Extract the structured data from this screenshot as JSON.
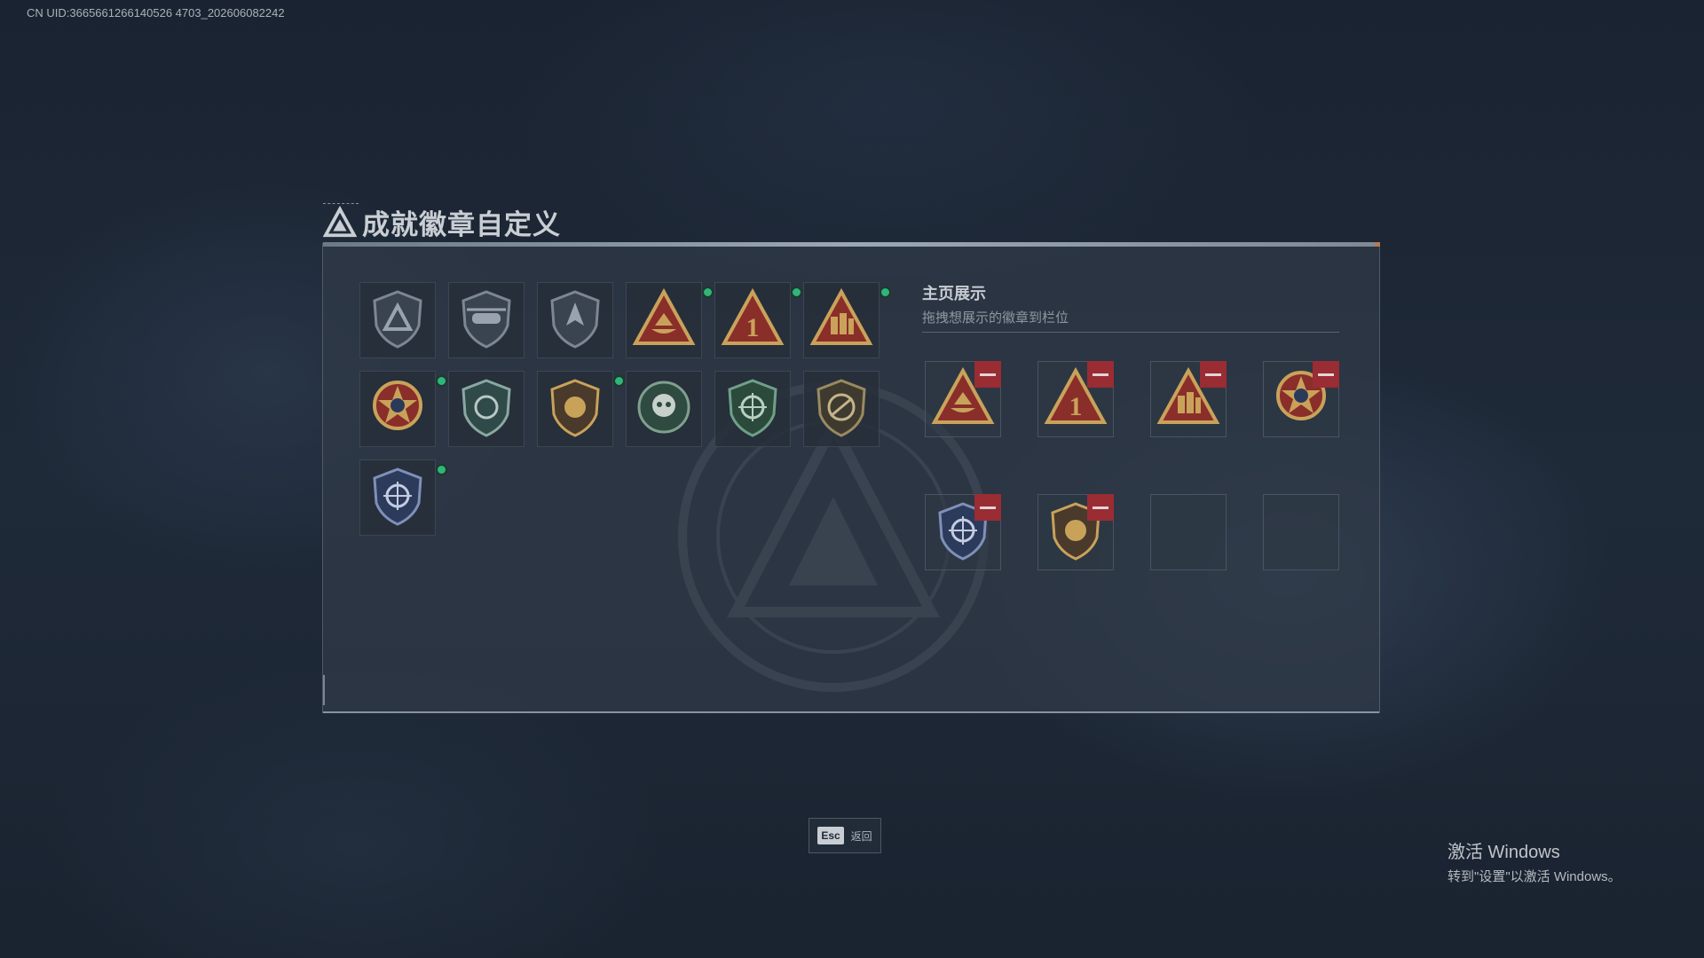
{
  "uid_text": "CN UID:3665661266140526 4703_202606082242",
  "title": "成就徽章自定义",
  "display": {
    "title": "主页展示",
    "subtitle": "拖拽想展示的徽章到栏位"
  },
  "badges": [
    {
      "icon": "shield-triangle-badge-icon",
      "new": false
    },
    {
      "icon": "helicopter-badge-icon",
      "new": false
    },
    {
      "icon": "arrow-shield-badge-icon",
      "new": false
    },
    {
      "icon": "boat-triangle-badge-icon",
      "new": true
    },
    {
      "icon": "number-one-triangle-badge-icon",
      "new": true,
      "label": "1"
    },
    {
      "icon": "soldiers-triangle-badge-icon",
      "new": true
    },
    {
      "icon": "star-medal-badge-icon",
      "new": true
    },
    {
      "icon": "green-shield-badge-icon",
      "new": false
    },
    {
      "icon": "lion-shield-badge-icon",
      "new": true
    },
    {
      "icon": "skull-wreath-badge-icon",
      "new": false
    },
    {
      "icon": "crosshair-green-badge-icon",
      "new": false
    },
    {
      "icon": "rifle-shield-badge-icon",
      "new": false
    },
    {
      "icon": "crosshair-blue-badge-icon",
      "new": true
    }
  ],
  "showcase_slots": [
    {
      "icon": "boat-triangle-badge-icon",
      "filled": true
    },
    {
      "icon": "number-one-triangle-badge-icon",
      "filled": true,
      "label": "1"
    },
    {
      "icon": "soldiers-triangle-badge-icon",
      "filled": true
    },
    {
      "icon": "star-medal-badge-icon",
      "filled": true
    },
    {
      "icon": "crosshair-blue-badge-icon",
      "filled": true
    },
    {
      "icon": "lion-shield-badge-icon",
      "filled": true
    },
    {
      "icon": "",
      "filled": false
    },
    {
      "icon": "",
      "filled": false
    }
  ],
  "footer": {
    "esc_key": "Esc",
    "esc_label": "返回"
  },
  "watermark_windows": {
    "title": "激活 Windows",
    "subtitle": "转到\"设置\"以激活 Windows。"
  },
  "colors": {
    "new_dot": "#2fb67a",
    "remove_button": "#9a2c33",
    "gold": "#c9a25a",
    "triangle_red": "#8a2e2a"
  }
}
